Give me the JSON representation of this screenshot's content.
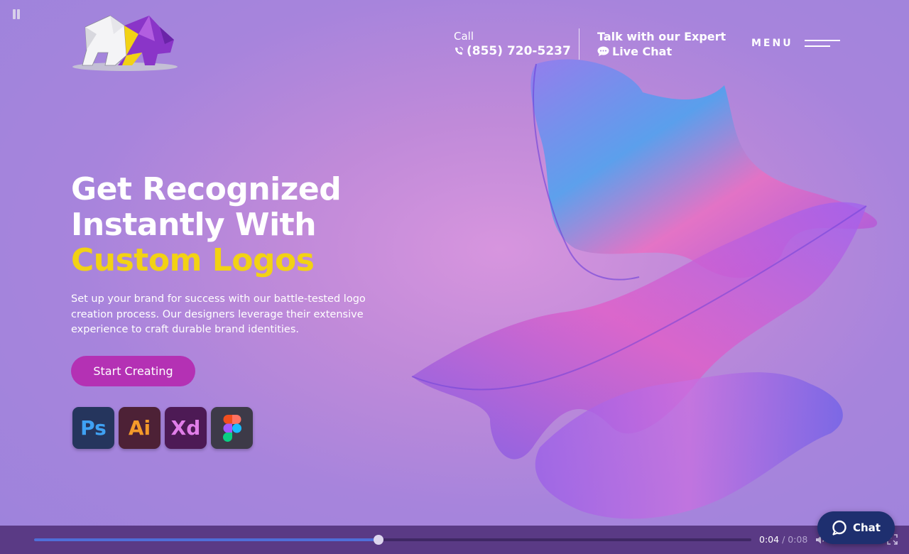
{
  "header": {
    "logo_icon": "origami-bear-logo",
    "call_label": "Call",
    "phone_icon": "phone-ringing-icon",
    "phone_number": "(855) 720-5237",
    "expert_label": "Talk with our Expert",
    "chat_icon": "chat-bubble-icon",
    "live_chat_label": "Live Chat",
    "menu_label": "MENU",
    "menu_icon": "hamburger-icon"
  },
  "hero": {
    "title_line1": "Get Recognized",
    "title_line2": "Instantly With",
    "title_line3": "Custom Logos",
    "description": "Set up your brand for success with our battle-tested logo creation process. Our designers leverage their extensive experience to craft durable brand identities.",
    "cta_label": "Start Creating",
    "tools": [
      {
        "label": "Ps",
        "icon": "photoshop-icon"
      },
      {
        "label": "Ai",
        "icon": "illustrator-icon"
      },
      {
        "label": "Xd",
        "icon": "adobe-xd-icon"
      },
      {
        "label": "",
        "icon": "figma-icon"
      }
    ]
  },
  "video": {
    "current_time": "0:04",
    "separator": "/",
    "total_time": "0:08",
    "progress": 0.48,
    "icons": [
      "pause-icon",
      "volume-muted-icon",
      "fullscreen-icon"
    ]
  },
  "chat_widget": {
    "label": "Chat",
    "icon": "chat-bubble-icon"
  },
  "colors": {
    "accent_yellow": "#f2d214",
    "cta_magenta": "#b431b4",
    "chat_navy": "#1e2f6f",
    "progress_blue": "#4f6fd8"
  }
}
